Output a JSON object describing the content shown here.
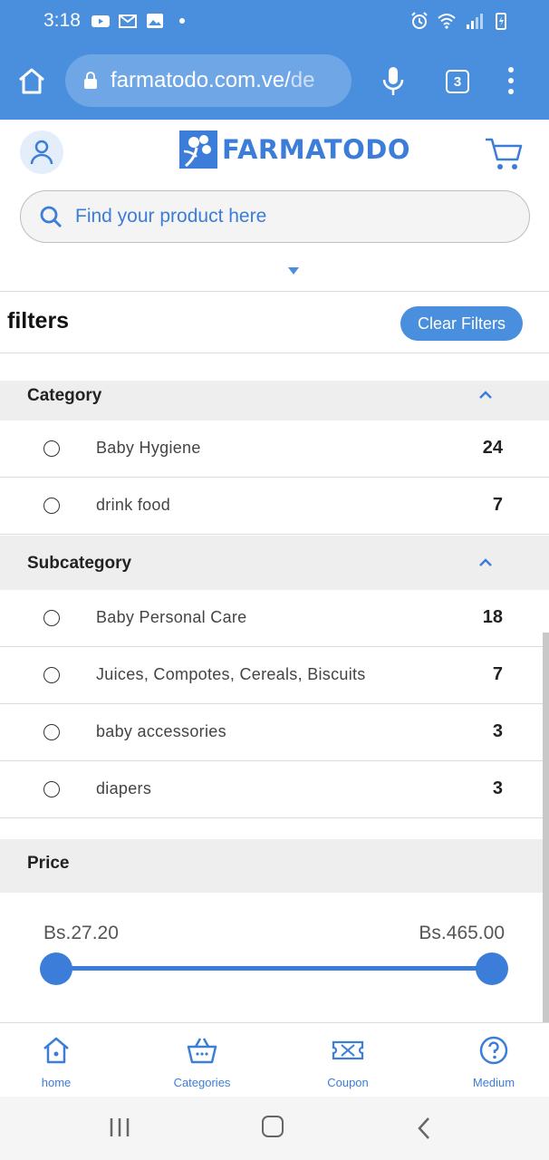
{
  "status_bar": {
    "time": "3:18",
    "icons_left": [
      "youtube-icon",
      "gmail-icon",
      "gallery-icon",
      "dot-icon"
    ],
    "icons_right": [
      "alarm-icon",
      "wifi-icon",
      "signal-icon",
      "battery-charging-icon"
    ]
  },
  "browser": {
    "url_main": "farmatodo.com.ve/",
    "url_faded": "de",
    "tab_count": "3"
  },
  "header": {
    "logo_text": "FARMATODO",
    "search_placeholder": "Find your product here"
  },
  "filters": {
    "title": "filters",
    "clear_label": "Clear Filters"
  },
  "category": {
    "title": "Category",
    "items": [
      {
        "label": "Baby Hygiene",
        "count": "24"
      },
      {
        "label": "drink food",
        "count": "7"
      }
    ]
  },
  "subcategory": {
    "title": "Subcategory",
    "items": [
      {
        "label": "Baby Personal Care",
        "count": "18"
      },
      {
        "label": "Juices, Compotes, Cereals, Biscuits",
        "count": "7"
      },
      {
        "label": "baby accessories",
        "count": "3"
      },
      {
        "label": "diapers",
        "count": "3"
      }
    ]
  },
  "price": {
    "title": "Price",
    "min_label": "Bs.27.20",
    "max_label": "Bs.465.00"
  },
  "bottom_nav": {
    "items": [
      {
        "label": "home",
        "icon": "home-icon"
      },
      {
        "label": "Categories",
        "icon": "basket-icon"
      },
      {
        "label": "Coupon",
        "icon": "coupon-icon"
      },
      {
        "label": "Medium",
        "icon": "help-icon"
      }
    ]
  },
  "colors": {
    "brand_blue": "#4a8fdd",
    "accent_blue": "#3b7dd8",
    "section_gray": "#eeeeee"
  }
}
